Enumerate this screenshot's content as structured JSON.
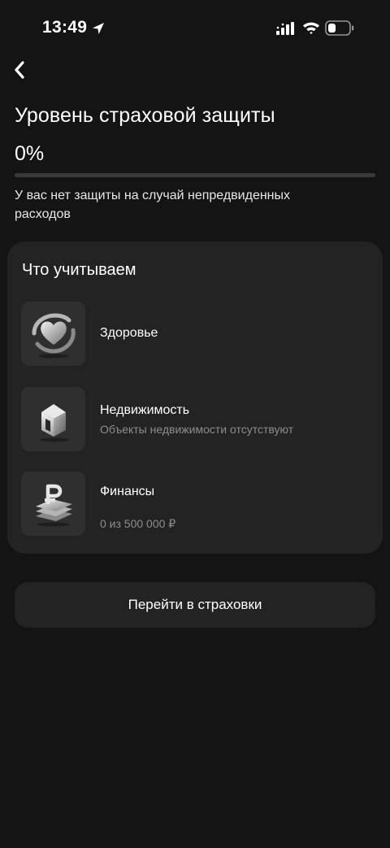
{
  "status_bar": {
    "time": "13:49",
    "icons": [
      "location-arrow-icon",
      "signal-icon",
      "wifi-icon",
      "battery-icon"
    ]
  },
  "nav": {
    "back_icon": "chevron-left-icon"
  },
  "header": {
    "title": "Уровень страховой защиты",
    "percent_label": "0%",
    "progress": 0,
    "note": "У вас нет защиты на случай непредвиденных расходов"
  },
  "factors": {
    "title": "Что учитываем",
    "items": [
      {
        "label": "Здоровье",
        "subtitle": "",
        "icon": "health-icon"
      },
      {
        "label": "Недвижимость",
        "subtitle": "Объекты недвижимости отсутствуют",
        "icon": "house-icon"
      },
      {
        "label": "Финансы",
        "subtitle": "0 из 500 000 ₽",
        "icon": "finance-icon"
      }
    ]
  },
  "actions": {
    "go_to_insurance": "Перейти в страховки"
  },
  "colors": {
    "background": "#141414",
    "card": "#232323",
    "thumb": "#2f2f2f",
    "progress_track": "#3a3a3a",
    "muted_text": "#8d8d8d"
  }
}
